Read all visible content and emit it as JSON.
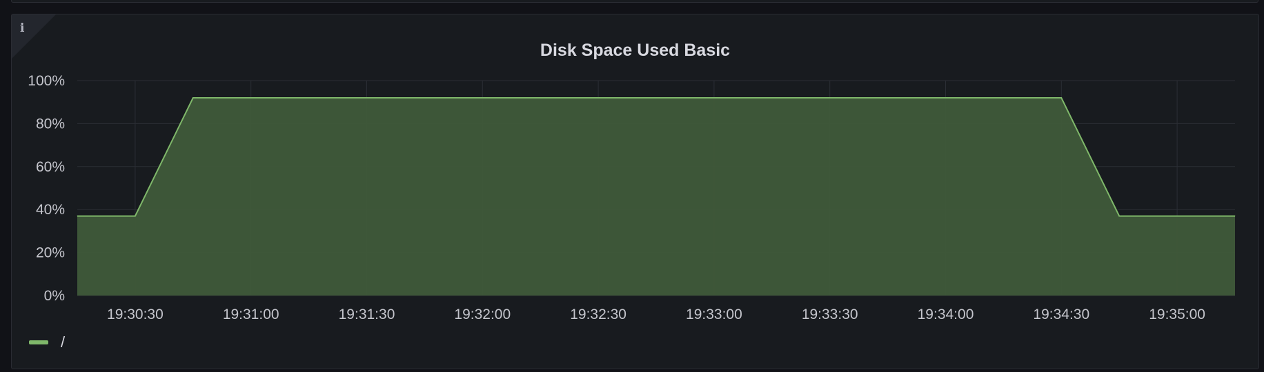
{
  "panel": {
    "title": "Disk Space Used Basic",
    "info_icon": "info-icon"
  },
  "colors": {
    "background": "#111217",
    "panel": "#181b1f",
    "grid": "#2b2e35",
    "series_line": "#7fb86a",
    "series_fill": "#3f5a3a"
  },
  "chart_data": {
    "type": "area",
    "title": "Disk Space Used Basic",
    "xlabel": "",
    "ylabel": "",
    "x_ticks": [
      "19:30:30",
      "19:31:00",
      "19:31:30",
      "19:32:00",
      "19:32:30",
      "19:33:00",
      "19:33:30",
      "19:34:00",
      "19:34:30",
      "19:35:00"
    ],
    "y_ticks": [
      "0%",
      "20%",
      "40%",
      "60%",
      "80%",
      "100%"
    ],
    "ylim": [
      0,
      100
    ],
    "xlim": [
      "19:30:15",
      "19:35:15"
    ],
    "grid": true,
    "legend_position": "bottom-left",
    "series": [
      {
        "name": "/",
        "x": [
          "19:30:15",
          "19:30:30",
          "19:30:45",
          "19:31:00",
          "19:31:30",
          "19:32:00",
          "19:32:30",
          "19:33:00",
          "19:33:30",
          "19:34:00",
          "19:34:30",
          "19:34:45",
          "19:35:00",
          "19:35:15"
        ],
        "values": [
          37,
          37,
          92,
          92,
          92,
          92,
          92,
          92,
          92,
          92,
          92,
          37,
          37,
          37
        ]
      }
    ]
  }
}
